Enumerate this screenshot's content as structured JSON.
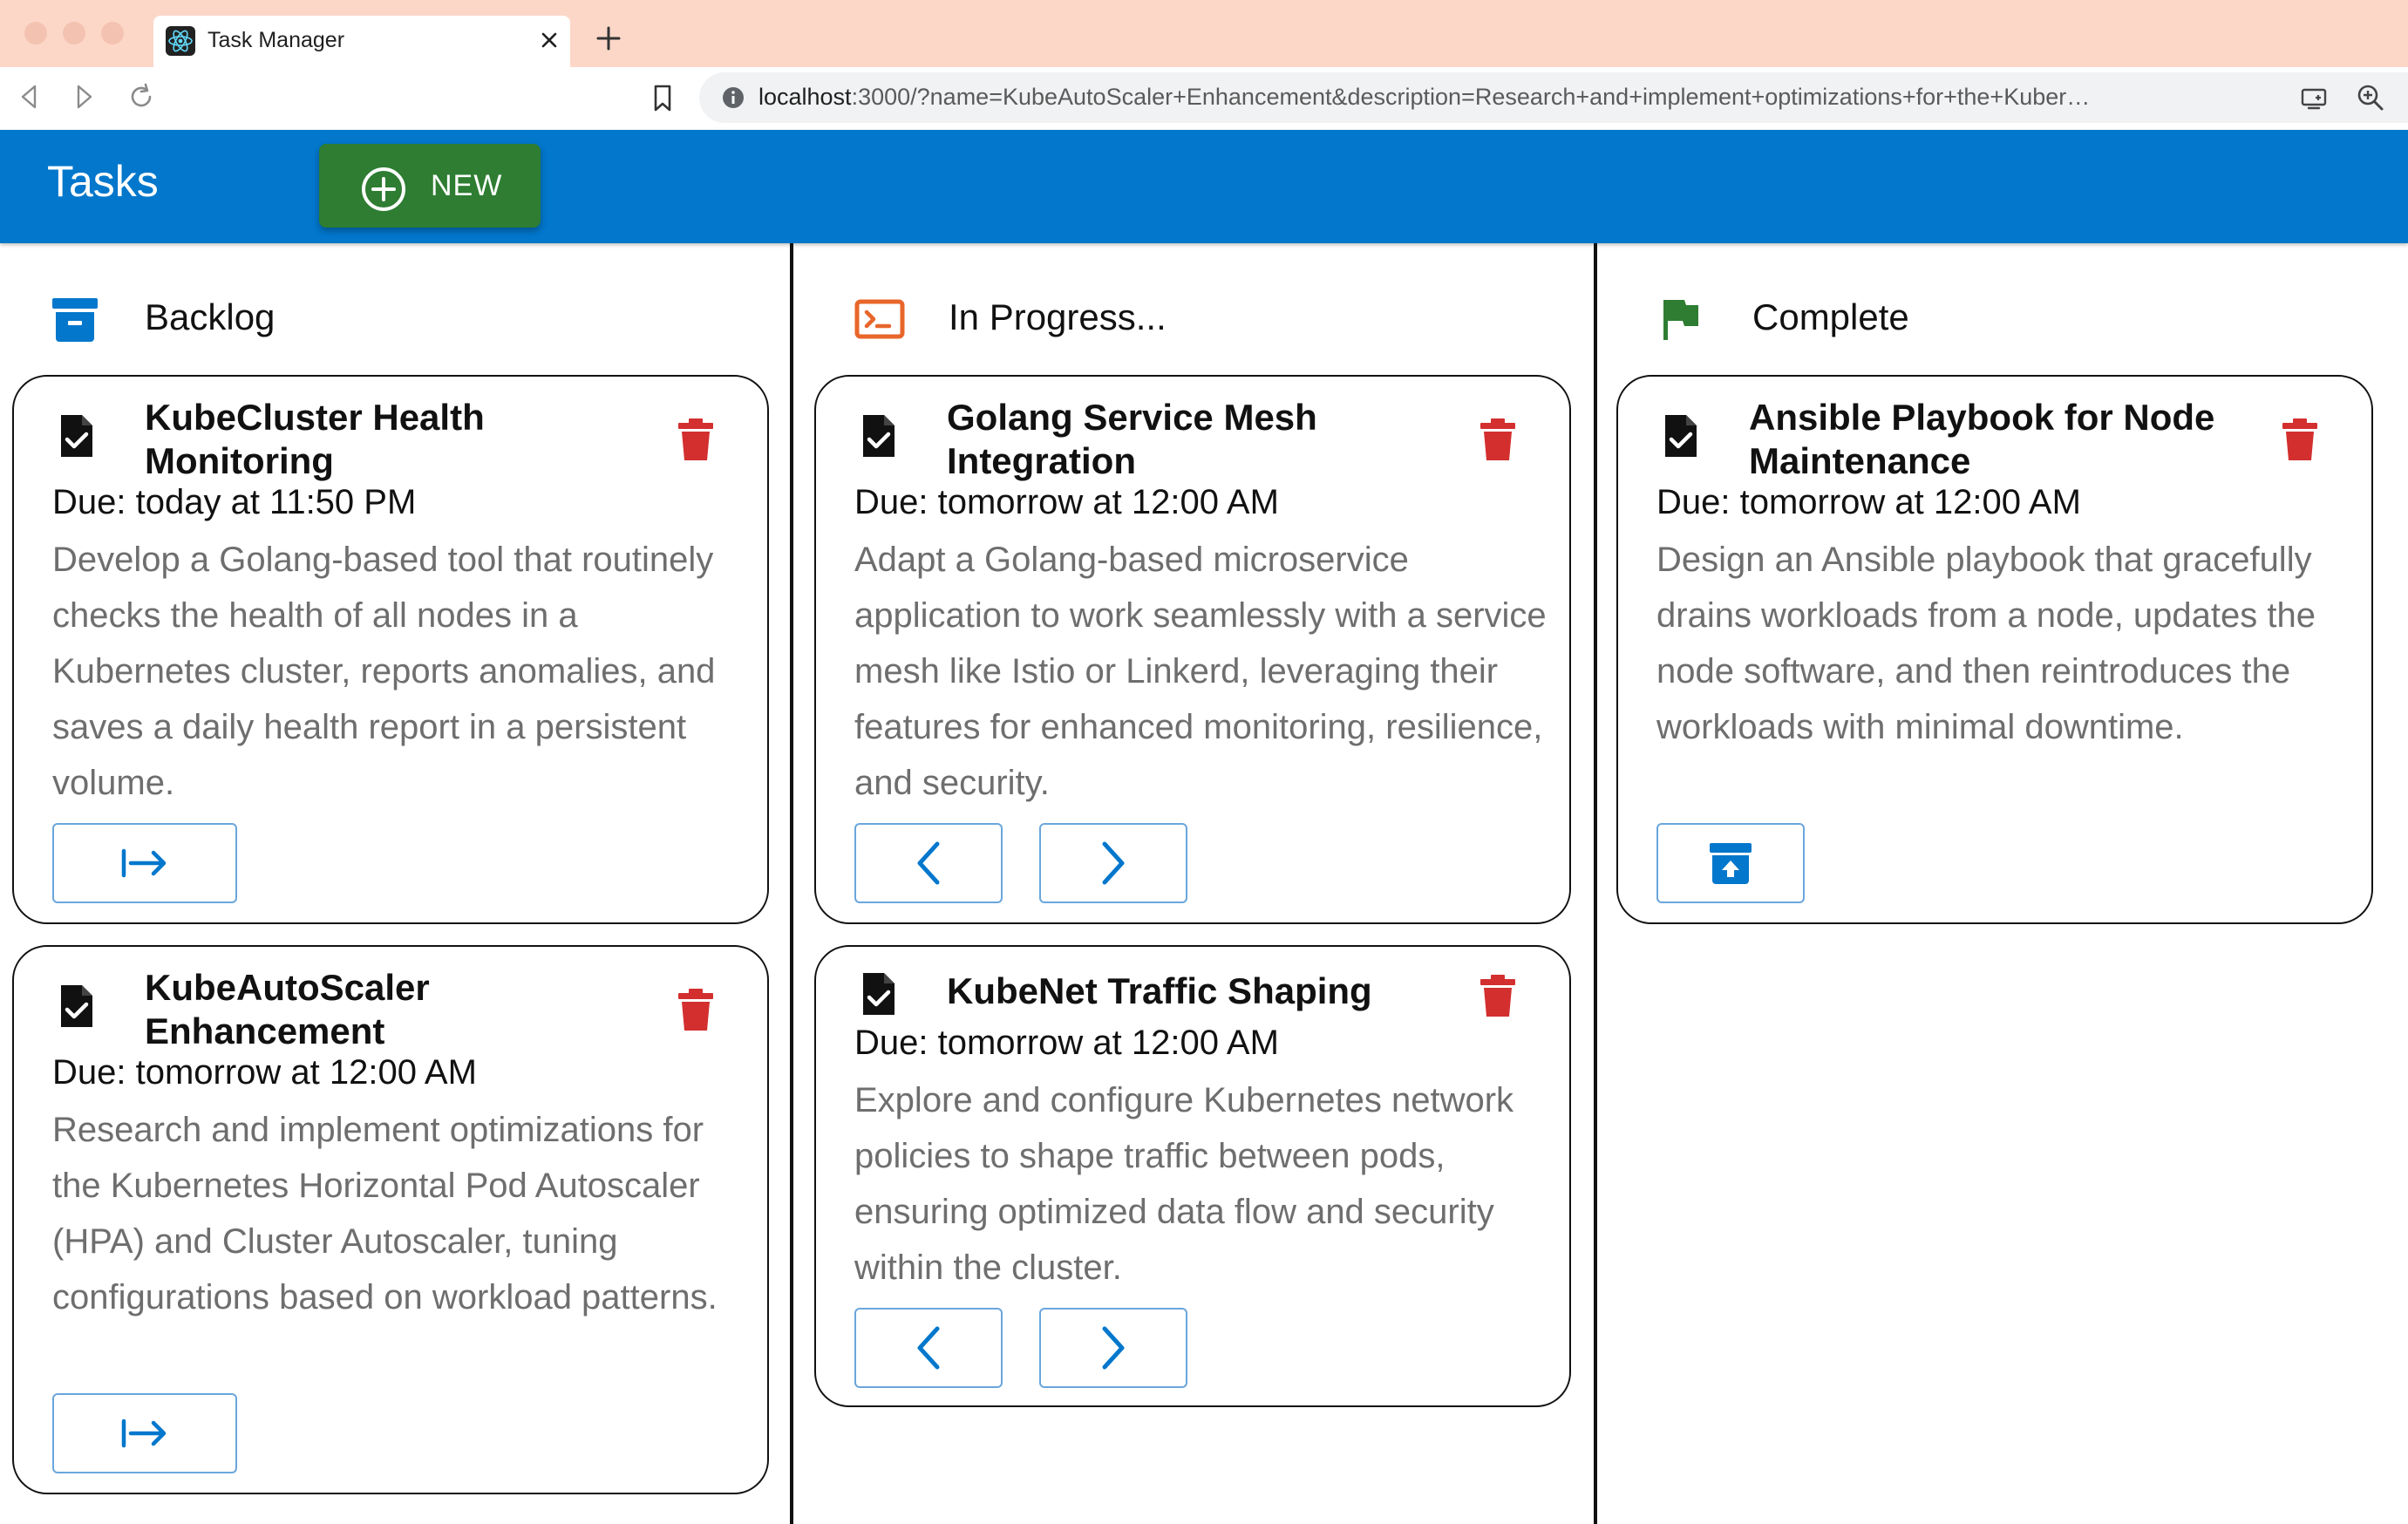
{
  "browser": {
    "tab_title": "Task Manager",
    "url_host": "localhost",
    "url_rest": ":3000/?name=KubeAutoScaler+Enhancement&description=Research+and+implement+optimizations+for+the+Kubernete..."
  },
  "header": {
    "title": "Tasks",
    "new_label": "NEW"
  },
  "colors": {
    "header_bg": "#0277cc",
    "new_button_bg": "#2e7d32",
    "delete_red": "#d32f2f",
    "accent_blue": "#0277cc",
    "progress_orange": "#e8662a",
    "complete_green": "#2e7d32"
  },
  "columns": [
    {
      "title": "Backlog",
      "icon": "archive-icon",
      "cards": [
        {
          "title": "KubeCluster Health Monitoring",
          "due": "Due: today at 11:50 PM",
          "description": "Develop a Golang-based tool that routinely checks the health of all nodes in a Kubernetes cluster, reports anomalies, and saves a daily health report in a persistent volume.",
          "actions": [
            "move-to-progress-icon"
          ]
        },
        {
          "title": "KubeAutoScaler Enhancement",
          "due": "Due: tomorrow at 12:00 AM",
          "description": "Research and implement optimizations for the Kubernetes Horizontal Pod Autoscaler (HPA) and Cluster Autoscaler, tuning configurations based on workload patterns.",
          "actions": [
            "move-to-progress-icon"
          ]
        }
      ]
    },
    {
      "title": "In Progress...",
      "icon": "terminal-icon",
      "cards": [
        {
          "title": "Golang Service Mesh Integration",
          "due": "Due: tomorrow at 12:00 AM",
          "description": "Adapt a Golang-based microservice application to work seamlessly with a service mesh like Istio or Linkerd, leveraging their features for enhanced monitoring, resilience, and security.",
          "actions": [
            "chevron-left-icon",
            "chevron-right-icon"
          ]
        },
        {
          "title": "KubeNet Traffic Shaping",
          "due": "Due: tomorrow at 12:00 AM",
          "description": "Explore and configure Kubernetes network policies to shape traffic between pods, ensuring optimized data flow and security within the cluster.",
          "actions": [
            "chevron-left-icon",
            "chevron-right-icon"
          ]
        }
      ]
    },
    {
      "title": "Complete",
      "icon": "flag-icon",
      "cards": [
        {
          "title": "Ansible Playbook for Node Maintenance",
          "due": "Due: tomorrow at 12:00 AM",
          "description": "Design an Ansible playbook that gracefully drains workloads from a node, updates the node software, and then reintroduces the workloads with minimal downtime.",
          "actions": [
            "unarchive-icon"
          ]
        }
      ]
    }
  ]
}
